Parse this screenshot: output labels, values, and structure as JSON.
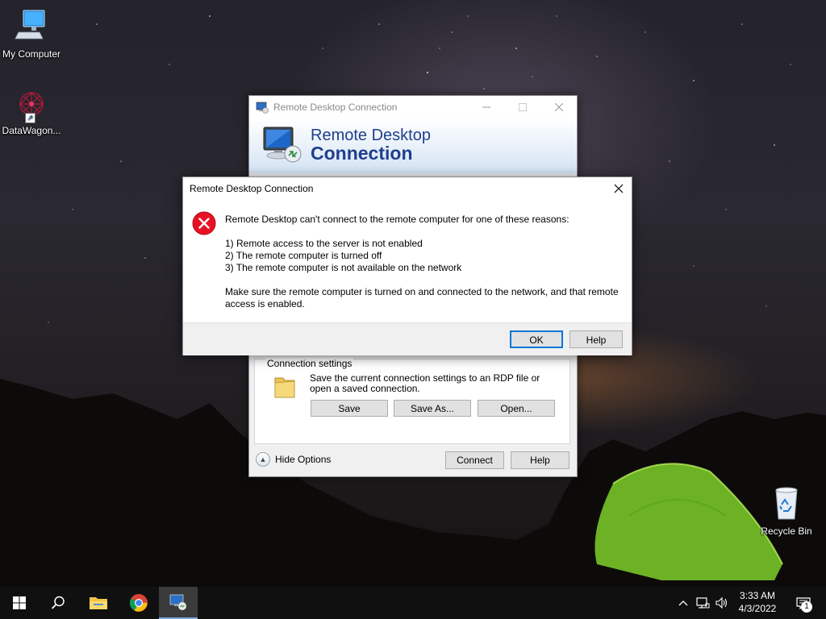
{
  "desktop": {
    "icons": [
      {
        "label": "My Computer"
      },
      {
        "label": "DataWagon..."
      },
      {
        "label": "Recycle Bin"
      }
    ]
  },
  "rdc_window": {
    "title": "Remote Desktop Connection",
    "banner_line1": "Remote Desktop",
    "banner_line2": "Connection",
    "connection_settings": {
      "legend": "Connection settings",
      "description": "Save the current connection settings to an RDP file or open a saved connection.",
      "save_label": "Save",
      "save_as_label": "Save As...",
      "open_label": "Open..."
    },
    "hide_options_label": "Hide Options",
    "connect_label": "Connect",
    "help_label": "Help"
  },
  "error_dialog": {
    "title": "Remote Desktop Connection",
    "message": "Remote Desktop can't connect to the remote computer for one of these reasons:",
    "reasons": [
      "1) Remote access to the server is not enabled",
      "2) The remote computer is turned off",
      "3) The remote computer is not available on the network"
    ],
    "advice": "Make sure the remote computer is turned on and connected to the network, and that remote access is enabled.",
    "ok_label": "OK",
    "help_label": "Help"
  },
  "taskbar": {
    "apps": [
      "start",
      "search",
      "file-explorer",
      "chrome",
      "remote-desktop"
    ],
    "active_app": "remote-desktop",
    "clock_time": "3:33 AM",
    "clock_date": "4/3/2022",
    "notification_count": "1"
  },
  "colors": {
    "banner_text": "#1e3f8c",
    "error_red": "#e81123",
    "focus_blue": "#0078d7",
    "taskbar_bg": "#101010"
  }
}
